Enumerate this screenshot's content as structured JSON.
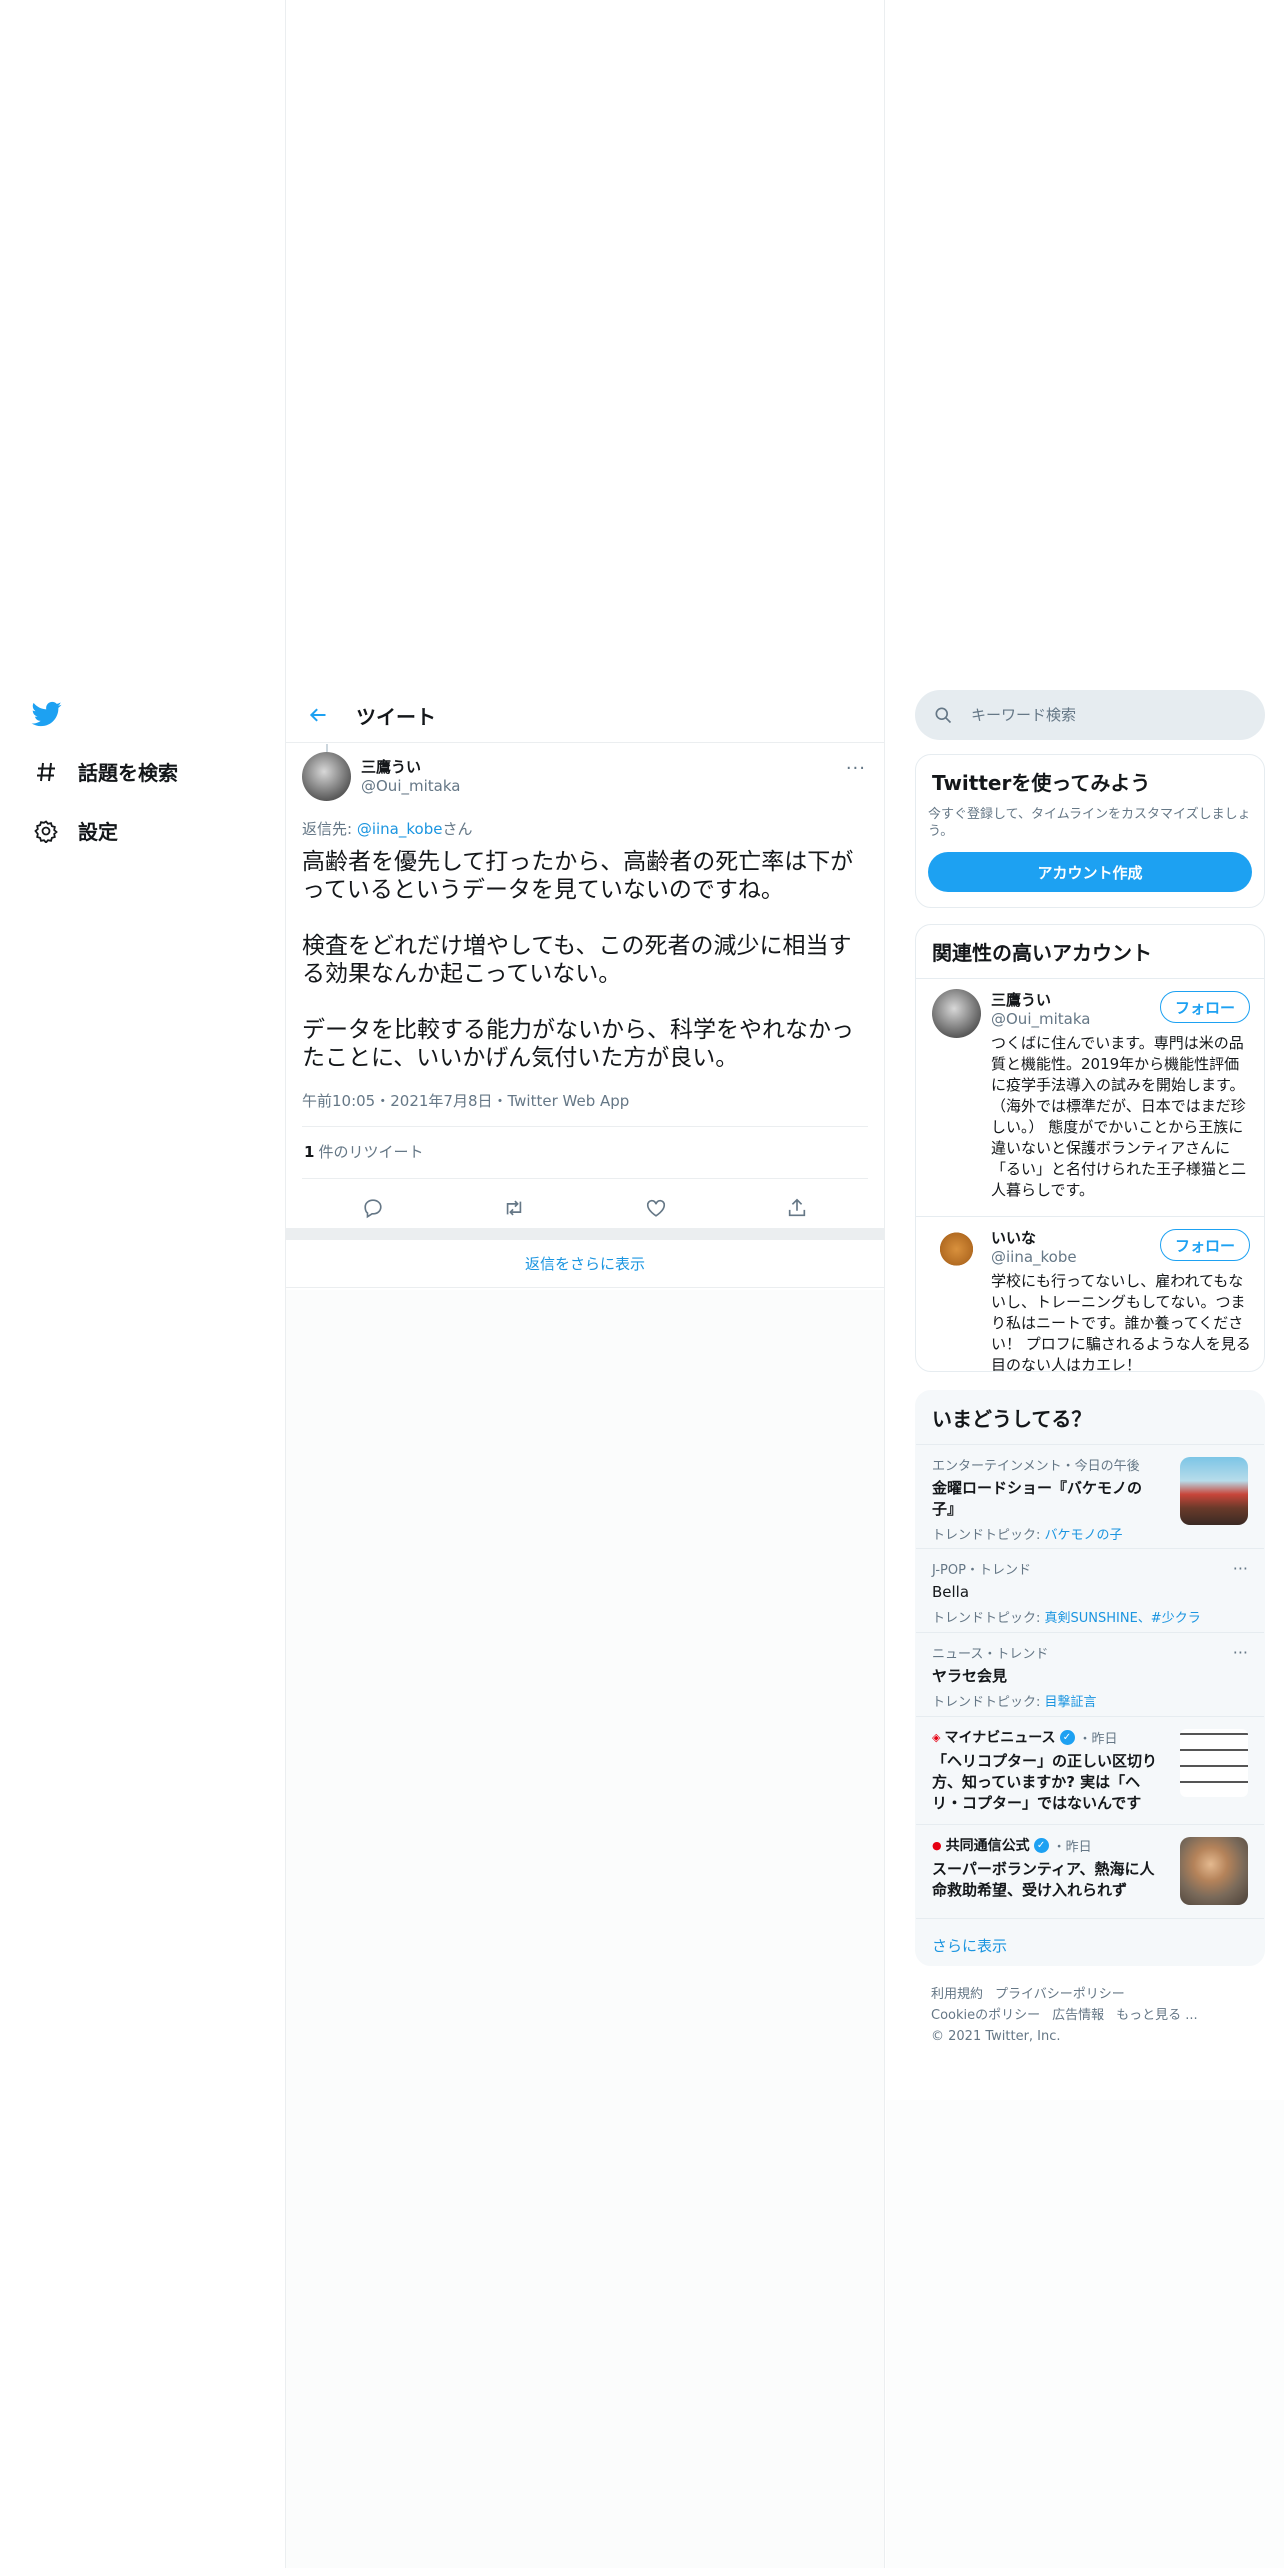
{
  "nav": {
    "logo": "twitter-bird-icon",
    "explore_label": "話題を検索",
    "settings_label": "設定"
  },
  "header": {
    "title": "ツイート"
  },
  "tweet": {
    "author_name": "三鷹うい",
    "author_handle": "@Oui_mitaka",
    "reply_prefix": "返信先: ",
    "reply_handle": "@iina_kobe",
    "reply_suffix": "さん",
    "paragraphs": [
      "高齢者を優先して打ったから、高齢者の死亡率は下がっているというデータを見ていないのですね。",
      "検査をどれだけ増やしても、この死者の減少に相当する効果なんか起こっていない。",
      "データを比較する能力がないから、科学をやれなかったことに、いいかげん気付いた方が良い。"
    ],
    "meta": "午前10:05・2021年7月8日・Twitter Web App",
    "retweet_count": "1",
    "retweet_label": "件のリツイート"
  },
  "show_more_replies": "返信をさらに表示",
  "search": {
    "placeholder": "キーワード検索"
  },
  "signup": {
    "title": "Twitterを使ってみよう",
    "subtitle": "今すぐ登録して、タイムラインをカスタマイズしましょう。",
    "button": "アカウント作成"
  },
  "related": {
    "title": "関連性の高いアカウント",
    "accounts": [
      {
        "name": "三鷹うい",
        "handle": "@Oui_mitaka",
        "follow": "フォロー",
        "bio": "つくばに住んでいます。専門は米の品質と機能性。2019年から機能性評価に疫学手法導入の試みを開始します。（海外では標準だが、日本ではまだ珍しい。） 態度がでかいことから王族に違いないと保護ボランティアさんに「るい」と名付けられた王子様猫と二人暮らしです。"
      },
      {
        "name": "いいな",
        "handle": "@iina_kobe",
        "follow": "フォロー",
        "bio": "学校にも行ってないし、雇われてもないし、トレーニングもしてない。つまり私はニートです。誰か養ってください！ プロフに騙されるような人を見る目のない人はカエレ！"
      }
    ]
  },
  "trends": {
    "title": "いまどうしてる？",
    "items": [
      {
        "context": "エンターテインメント・今日の午後",
        "title": "金曜ロードショー『バケモノの子』",
        "topic_prefix": "トレンドトピック: ",
        "topic": "バケモノの子"
      },
      {
        "context": "J-POP・トレンド",
        "title": "Bella",
        "topic_prefix": "トレンドトピック: ",
        "topic": "真剣SUNSHINE、#少クラ"
      },
      {
        "context": "ニュース・トレンド",
        "title": "ヤラセ会見",
        "topic_prefix": "トレンドトピック: ",
        "topic": "目撃証言"
      },
      {
        "source": "マイナビニュース",
        "time": "・昨日",
        "title": "「ヘリコプター」の正しい区切り方、知っていますか? 実は「ヘリ・コプター」ではないんです"
      },
      {
        "source": "共同通信公式",
        "time": "・昨日",
        "title": "スーパーボランティア、熱海に人命救助希望、受け入れられず"
      }
    ],
    "more": "さらに表示"
  },
  "footer": {
    "terms": "利用規約",
    "privacy": "プライバシーポリシー",
    "cookie": "Cookieのポリシー",
    "ads": "広告情報",
    "more": "もっと見る ...",
    "copyright": "© 2021 Twitter, Inc."
  },
  "colors": {
    "accent": "#1da1f2",
    "link": "#1b95e0",
    "muted": "#657786"
  }
}
